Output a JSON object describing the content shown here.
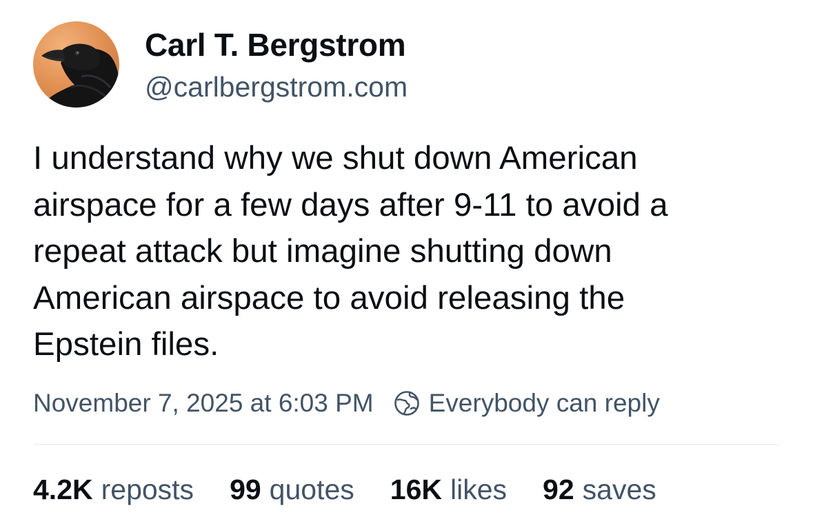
{
  "author": {
    "name": "Carl T. Bergstrom",
    "handle": "@carlbergstrom.com",
    "avatar_icon": "crow-avatar-icon"
  },
  "post": {
    "text_lines": [
      "I understand why we shut down American",
      "airspace for a few days after 9-11 to avoid a",
      "repeat attack but imagine shutting down",
      "American airspace to avoid releasing the",
      "Epstein files."
    ],
    "timestamp": "November 7, 2025 at 6:03 PM",
    "reply_setting": {
      "label": "Everybody can reply",
      "icon": "globe-icon"
    }
  },
  "stats": [
    {
      "count": "4.2K",
      "label": "reposts"
    },
    {
      "count": "99",
      "label": "quotes"
    },
    {
      "count": "16K",
      "label": "likes"
    },
    {
      "count": "92",
      "label": "saves"
    }
  ],
  "colors": {
    "text_primary": "#0b0f14",
    "text_secondary": "#425466",
    "divider": "#e4e8ec",
    "avatar_bg": "#e59a5e"
  }
}
